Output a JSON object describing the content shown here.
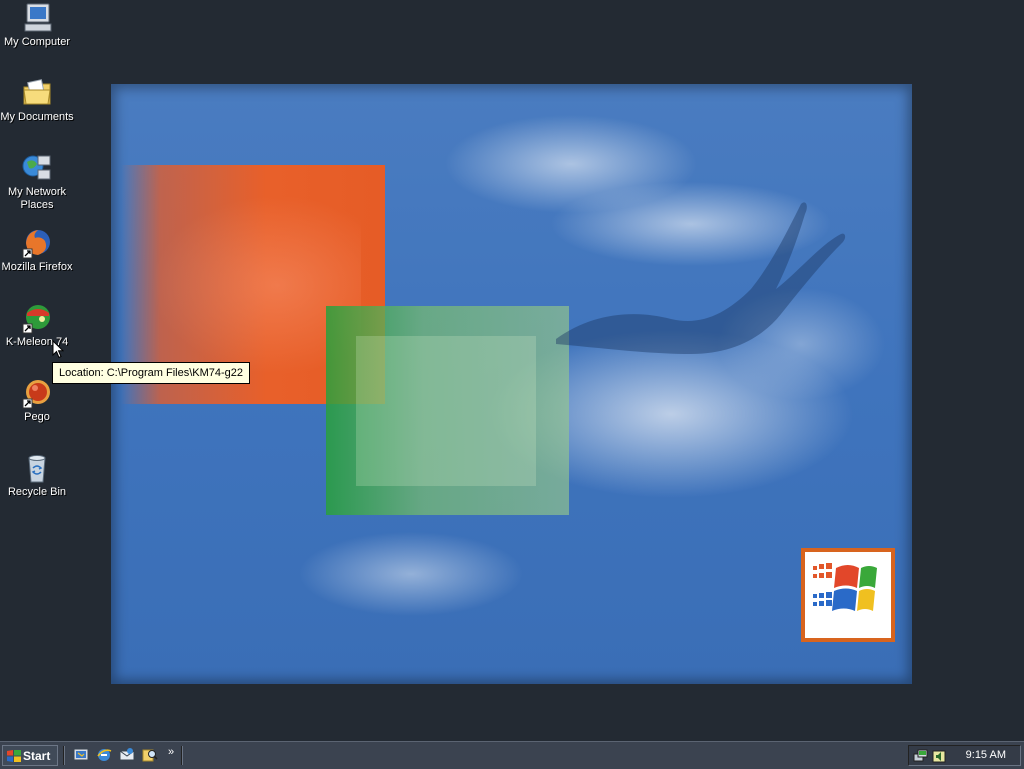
{
  "desktop": {
    "icons": [
      {
        "label": "My Computer",
        "icon": "computer-icon"
      },
      {
        "label": "My Documents",
        "icon": "folder-documents-icon"
      },
      {
        "label": "My Network Places",
        "icon": "network-places-icon"
      },
      {
        "label": "Mozilla Firefox",
        "icon": "firefox-icon"
      },
      {
        "label": "K-Meleon 74",
        "icon": "kmeleon-icon"
      },
      {
        "label": "Pego",
        "icon": "pego-icon"
      },
      {
        "label": "Recycle Bin",
        "icon": "recycle-bin-icon"
      }
    ],
    "tooltip": "Location: C:\\Program Files\\KM74-g22"
  },
  "taskbar": {
    "start_label": "Start",
    "quick_launch": [
      "show-desktop-icon",
      "internet-explorer-icon",
      "outlook-express-icon",
      "search-icon"
    ],
    "overflow": "»",
    "tray_icons": [
      "network-tray-icon",
      "volume-tray-icon"
    ],
    "clock": "9:15 AM"
  },
  "colors": {
    "desktop_bg": "#232a33",
    "wallpaper_sky": "#4a7cc0",
    "orange": "#e8602a",
    "green": "#5cb35c",
    "tooltip_bg": "#ffffe1"
  }
}
